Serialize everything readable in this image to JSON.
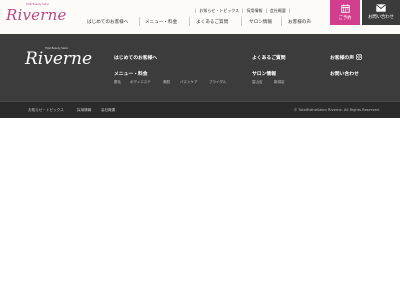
{
  "brand": {
    "logo_text": "Riverne",
    "logo_subtext": "Total Beauty Salon",
    "footer_logo_text": "Riverne",
    "footer_logo_subtext": "Total Beauty Salon"
  },
  "header": {
    "top_links": [
      "お知らせ・トピックス",
      "採用情報",
      "会社概要"
    ],
    "nav": [
      "はじめてのお客様へ",
      "メニュー・料金",
      "よくあるご質問",
      "サロン情報",
      "お客様の声"
    ],
    "reserve_label": "ご予約",
    "contact_label": "お問い合わせ"
  },
  "footer": {
    "first_visit": "はじめてのお客様へ",
    "menu": "メニュー・料金",
    "menu_items": [
      "脱毛",
      "ボディエステ",
      "美肌",
      "バストケア",
      "ブライダル"
    ],
    "faq": "よくあるご質問",
    "salon_info": "サロン情報",
    "salon_items": [
      "富山店",
      "新潟店"
    ],
    "voice": "お客様の声",
    "contact": "お問い合わせ"
  },
  "bottom": {
    "links": [
      "お知らせ・トピックス",
      "採用情報",
      "会社概要"
    ],
    "copyright": "© TotalEstheSalon Riverne. All Rights Reserved."
  },
  "colors": {
    "accent": "#d23d8d",
    "dark": "#3c3c3c",
    "darker": "#2b2b2b"
  }
}
